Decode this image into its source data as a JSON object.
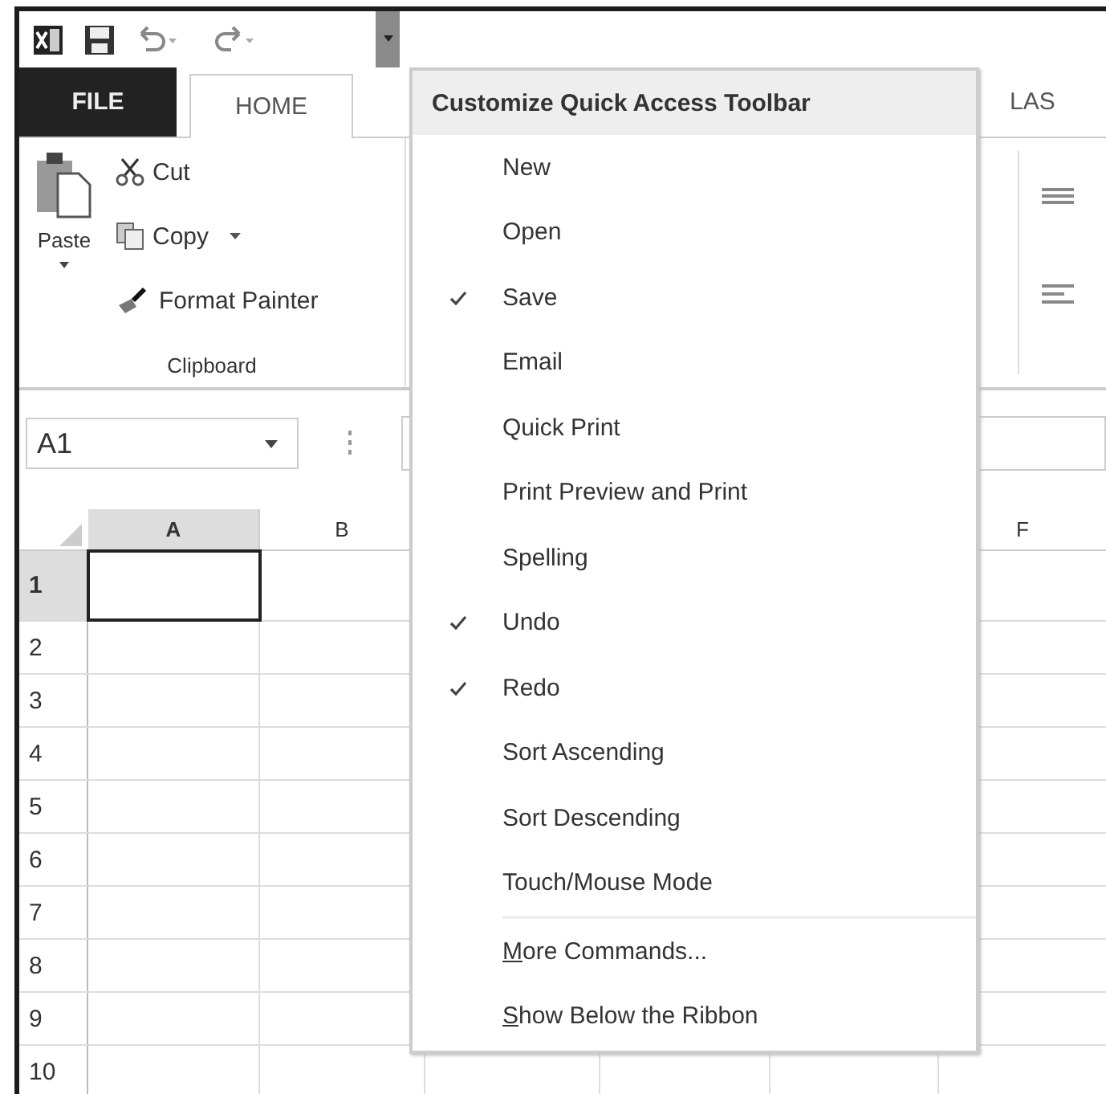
{
  "quick_access_toolbar": {
    "customize_menu_open": true
  },
  "tabs": [
    {
      "label": "FILE",
      "kind": "file",
      "selected": false
    },
    {
      "label": "HOME",
      "kind": "tab",
      "selected": true
    },
    {
      "label": "LAS",
      "kind": "tab",
      "selected": false
    }
  ],
  "clipboard": {
    "paste": "Paste",
    "group_label": "Clipboard",
    "commands": [
      {
        "label": "Cut",
        "kind": "cut",
        "dropdown": false
      },
      {
        "label": "Copy",
        "kind": "copy",
        "dropdown": true
      },
      {
        "label": "Format Painter",
        "kind": "painter",
        "dropdown": false
      }
    ]
  },
  "name_box": {
    "value": "A1"
  },
  "sheet": {
    "columns": [
      {
        "label": "A",
        "selected": true
      },
      {
        "label": "B",
        "selected": false
      },
      {
        "label": "F",
        "selected": false
      }
    ],
    "rows": [
      {
        "label": "1",
        "selected": true
      },
      {
        "label": "2",
        "selected": false
      },
      {
        "label": "3",
        "selected": false
      },
      {
        "label": "4",
        "selected": false
      },
      {
        "label": "5",
        "selected": false
      },
      {
        "label": "6",
        "selected": false
      },
      {
        "label": "7",
        "selected": false
      },
      {
        "label": "8",
        "selected": false
      },
      {
        "label": "9",
        "selected": false
      },
      {
        "label": "10",
        "selected": false
      }
    ]
  },
  "menu": {
    "title": "Customize Quick Access Toolbar",
    "items": [
      {
        "label": "New",
        "checked": false
      },
      {
        "label": "Open",
        "checked": false
      },
      {
        "label": "Save",
        "checked": true
      },
      {
        "label": "Email",
        "checked": false
      },
      {
        "label": "Quick Print",
        "checked": false
      },
      {
        "label": "Print Preview and Print",
        "checked": false
      },
      {
        "label": "Spelling",
        "checked": false
      },
      {
        "label": "Undo",
        "checked": true
      },
      {
        "label": "Redo",
        "checked": true
      },
      {
        "label": "Sort Ascending",
        "checked": false
      },
      {
        "label": "Sort Descending",
        "checked": false
      },
      {
        "label": "Touch/Mouse Mode",
        "checked": false
      }
    ],
    "footer_items": [
      {
        "label": "More Commands...",
        "underline_first": true
      },
      {
        "label": "Show Below the Ribbon",
        "underline_first": true
      }
    ]
  }
}
